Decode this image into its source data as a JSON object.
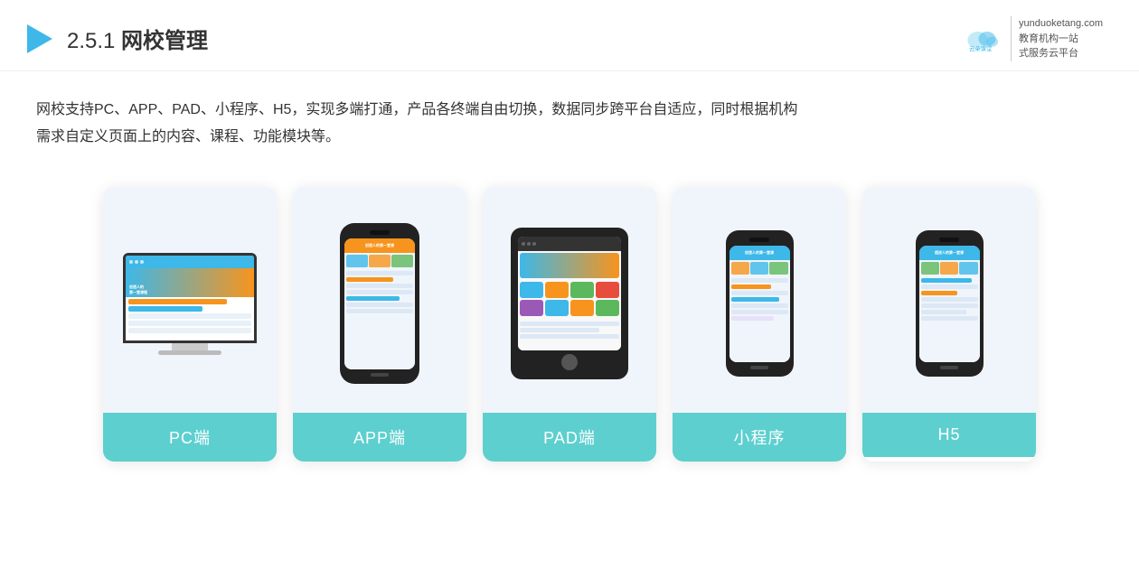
{
  "header": {
    "section_number": "2.5.1",
    "title_prefix": "2.5.1 ",
    "title": "网校管理",
    "brand_site": "yunduoketang.com",
    "brand_tagline": "教育机构一站\n式服务云平台"
  },
  "description": {
    "text": "网校支持PC、APP、PAD、小程序、H5，实现多端打通，产品各终端自由切换，数据同步跨平台自适应，同时根据机构需求自定义页面上的内容、课程、功能模块等。"
  },
  "cards": [
    {
      "id": "pc",
      "label": "PC端"
    },
    {
      "id": "app",
      "label": "APP端"
    },
    {
      "id": "pad",
      "label": "PAD端"
    },
    {
      "id": "miniapp",
      "label": "小程序"
    },
    {
      "id": "h5",
      "label": "H5"
    }
  ]
}
